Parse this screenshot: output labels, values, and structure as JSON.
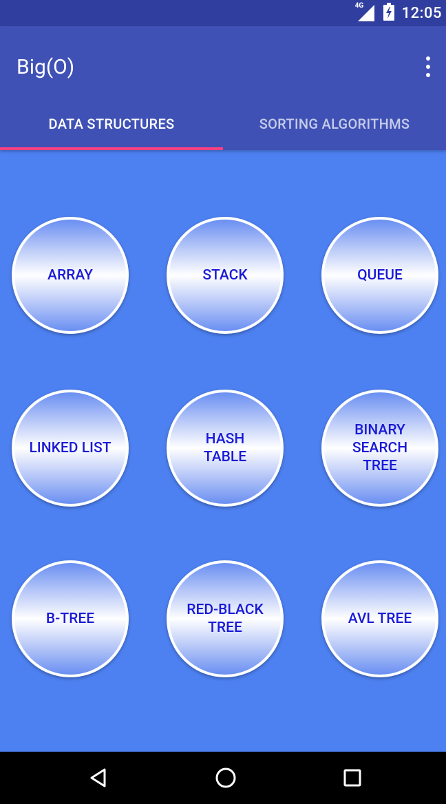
{
  "status_bar": {
    "network": "4G",
    "time": "12:05"
  },
  "app_bar": {
    "title": "Big(O)",
    "overflow_icon": "more-vertical-icon"
  },
  "tabs": [
    {
      "label": "DATA STRUCTURES",
      "active": true
    },
    {
      "label": "SORTING ALGORITHMS",
      "active": false
    }
  ],
  "data_structures": [
    {
      "label": "ARRAY"
    },
    {
      "label": "STACK"
    },
    {
      "label": "QUEUE"
    },
    {
      "label": "LINKED LIST"
    },
    {
      "label": "HASH\nTABLE"
    },
    {
      "label": "BINARY\nSEARCH\nTREE"
    },
    {
      "label": "B-TREE"
    },
    {
      "label": "RED-BLACK\nTREE"
    },
    {
      "label": "AVL TREE"
    }
  ],
  "nav_bar": {
    "back_icon": "back-triangle-icon",
    "home_icon": "home-circle-icon",
    "recents_icon": "recents-square-icon"
  },
  "colors": {
    "status_bar": "#303f9f",
    "app_bar": "#3f51b5",
    "tab_indicator": "#ff4081",
    "background": "#4d80f0",
    "circle_text": "#1a1ad6"
  }
}
